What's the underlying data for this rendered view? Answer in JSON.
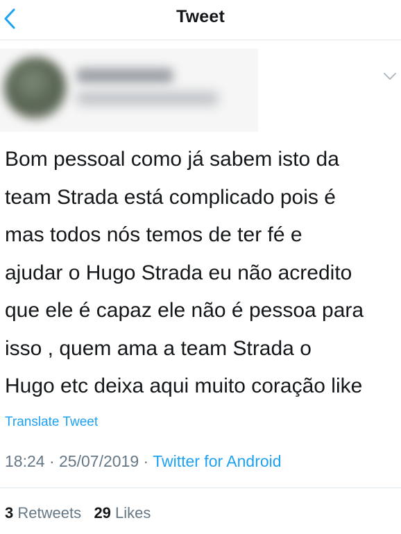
{
  "nav": {
    "title": "Tweet",
    "back_icon": "chevron-left-icon"
  },
  "author": {
    "display_name": "",
    "handle": "",
    "menu_icon": "chevron-down-icon"
  },
  "tweet": {
    "text_lines": [
      "Bom pessoal como já sabem isto da",
      "team Strada está complicado pois é",
      "mas todos nós temos de ter fé e",
      "ajudar o Hugo Strada eu não acredito",
      "que ele é capaz ele não é pessoa para",
      "isso , quem ama a team Strada o",
      "Hugo etc deixa aqui muito coração like"
    ],
    "translate_label": "Translate Tweet",
    "time": "18:24",
    "separator": "·",
    "date": "25/07/2019",
    "source": "Twitter for Android"
  },
  "stats": {
    "retweets_count": "3",
    "retweets_label": "Retweets",
    "likes_count": "29",
    "likes_label": "Likes"
  },
  "colors": {
    "accent": "#1da1f2",
    "text": "#14171a",
    "secondary": "#657786",
    "divider": "#e1e8ed"
  }
}
